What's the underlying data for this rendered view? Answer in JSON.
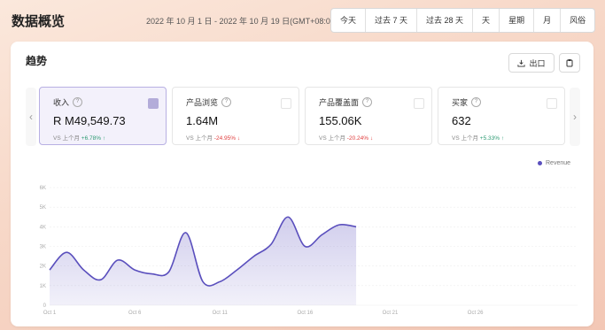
{
  "header": {
    "title": "数据概览",
    "date_range": "2022 年 10 月 1 日 - 2022 年 10 月 19 日(GMT+08:00)",
    "ranges": [
      "今天",
      "过去 7 天",
      "过去 28 天",
      "天",
      "星期",
      "月",
      "风俗"
    ]
  },
  "panel": {
    "title": "趋势",
    "export_label": "出口"
  },
  "metrics": [
    {
      "label": "收入",
      "value": "R M49,549.73",
      "compare": "VS 上个月",
      "change": "+6.78%",
      "arrow": "↑",
      "direction": "up",
      "selected": true
    },
    {
      "label": "产品浏览",
      "value": "1.64M",
      "compare": "VS 上个月",
      "change": "-24.95%",
      "arrow": "↓",
      "direction": "down",
      "selected": false
    },
    {
      "label": "产品覆盖面",
      "value": "155.06K",
      "compare": "VS 上个月",
      "change": "-20.24%",
      "arrow": "↓",
      "direction": "down",
      "selected": false
    },
    {
      "label": "买家",
      "value": "632",
      "compare": "VS 上个月",
      "change": "+5.33%",
      "arrow": "↑",
      "direction": "up",
      "selected": false
    }
  ],
  "chart_data": {
    "type": "area",
    "series": [
      {
        "name": "Revenue",
        "color": "#5a4fbd",
        "x": [
          1,
          2,
          3,
          4,
          5,
          6,
          7,
          8,
          9,
          10,
          11,
          12,
          13,
          14,
          15,
          16,
          17,
          18,
          19
        ],
        "values": [
          1.8,
          2.7,
          1.8,
          1.3,
          2.3,
          1.8,
          1.6,
          1.7,
          3.7,
          1.2,
          1.2,
          1.8,
          2.5,
          3.1,
          4.5,
          3.0,
          3.6,
          4.1,
          4.0
        ]
      }
    ],
    "x_ticks": [
      "Oct 1",
      "Oct 6",
      "Oct 11",
      "Oct 16",
      "Oct 21",
      "Oct 26"
    ],
    "x_tick_positions": [
      1,
      6,
      11,
      16,
      21,
      26
    ],
    "x_range": [
      1,
      32
    ],
    "y_ticks": [
      "0",
      "1K",
      "2K",
      "3K",
      "4K",
      "5K",
      "6K"
    ],
    "y_range": [
      0,
      6
    ],
    "legend": "top-right",
    "grid": true
  }
}
